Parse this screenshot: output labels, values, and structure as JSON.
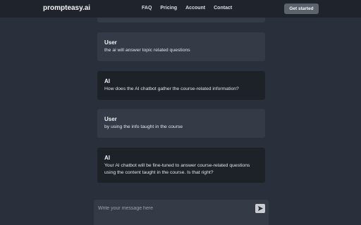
{
  "nav": {
    "logo": "prompteasy.ai",
    "links": [
      "FAQ",
      "Pricing",
      "Account",
      "Contact"
    ],
    "cta": "Get started"
  },
  "messages": [
    {
      "role": "User",
      "text": "the ai will answer topic related questions"
    },
    {
      "role": "AI",
      "text": "How does the AI chatbot gather the course-related information?"
    },
    {
      "role": "User",
      "text": "by using the info taught in the course"
    },
    {
      "role": "AI",
      "text": "Your AI chatbot will be fine-tuned to answer course-related questions using the content taught in the course. Is that right?"
    }
  ],
  "composer": {
    "placeholder": "Write your message here",
    "send_icon": "send-icon"
  }
}
